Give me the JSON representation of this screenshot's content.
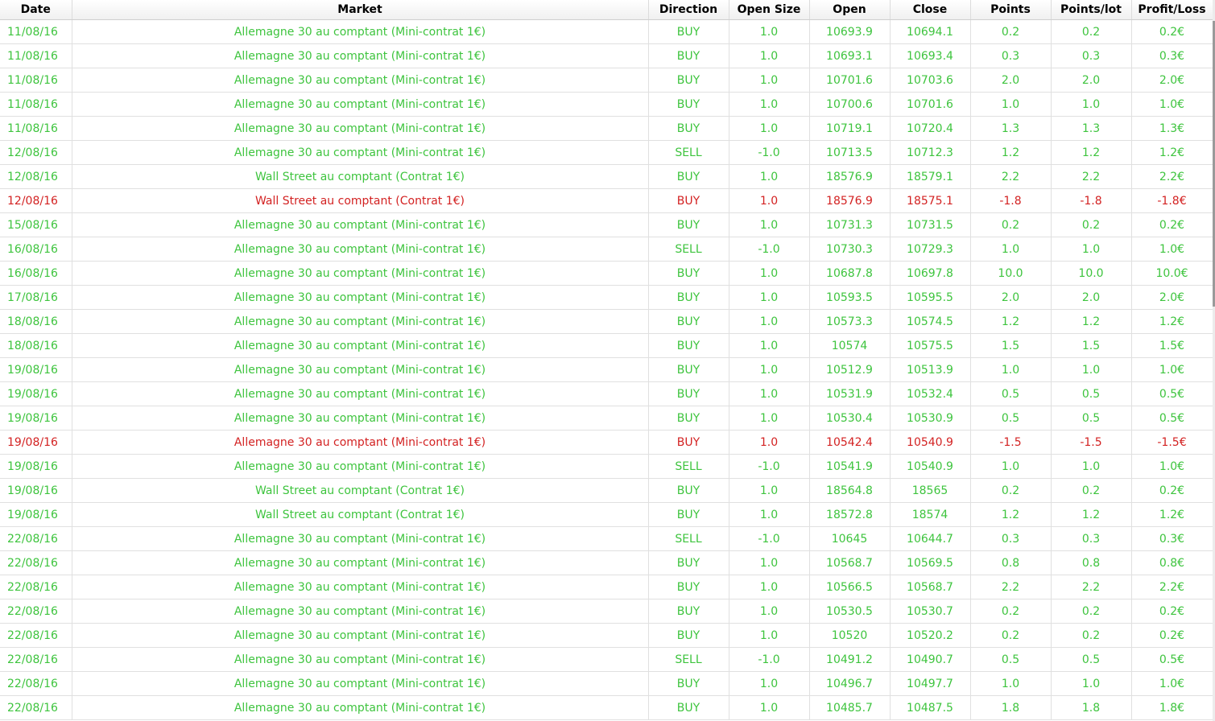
{
  "columns": [
    "Date",
    "Market",
    "Direction",
    "Open Size",
    "Open",
    "Close",
    "Points",
    "Points/lot",
    "Profit/Loss"
  ],
  "colors": {
    "profit": "#3ec43e",
    "loss": "#d32222"
  },
  "rows": [
    {
      "date": "11/08/16",
      "market": "Allemagne 30 au comptant (Mini-contrat 1€)",
      "direction": "BUY",
      "open_size": "1.0",
      "open": "10693.9",
      "close": "10694.1",
      "points": "0.2",
      "points_lot": "0.2",
      "pl": "0.2€",
      "status": "profit"
    },
    {
      "date": "11/08/16",
      "market": "Allemagne 30 au comptant (Mini-contrat 1€)",
      "direction": "BUY",
      "open_size": "1.0",
      "open": "10693.1",
      "close": "10693.4",
      "points": "0.3",
      "points_lot": "0.3",
      "pl": "0.3€",
      "status": "profit"
    },
    {
      "date": "11/08/16",
      "market": "Allemagne 30 au comptant (Mini-contrat 1€)",
      "direction": "BUY",
      "open_size": "1.0",
      "open": "10701.6",
      "close": "10703.6",
      "points": "2.0",
      "points_lot": "2.0",
      "pl": "2.0€",
      "status": "profit"
    },
    {
      "date": "11/08/16",
      "market": "Allemagne 30 au comptant (Mini-contrat 1€)",
      "direction": "BUY",
      "open_size": "1.0",
      "open": "10700.6",
      "close": "10701.6",
      "points": "1.0",
      "points_lot": "1.0",
      "pl": "1.0€",
      "status": "profit"
    },
    {
      "date": "11/08/16",
      "market": "Allemagne 30 au comptant (Mini-contrat 1€)",
      "direction": "BUY",
      "open_size": "1.0",
      "open": "10719.1",
      "close": "10720.4",
      "points": "1.3",
      "points_lot": "1.3",
      "pl": "1.3€",
      "status": "profit"
    },
    {
      "date": "12/08/16",
      "market": "Allemagne 30 au comptant (Mini-contrat 1€)",
      "direction": "SELL",
      "open_size": "-1.0",
      "open": "10713.5",
      "close": "10712.3",
      "points": "1.2",
      "points_lot": "1.2",
      "pl": "1.2€",
      "status": "profit"
    },
    {
      "date": "12/08/16",
      "market": "Wall Street au comptant (Contrat 1€)",
      "direction": "BUY",
      "open_size": "1.0",
      "open": "18576.9",
      "close": "18579.1",
      "points": "2.2",
      "points_lot": "2.2",
      "pl": "2.2€",
      "status": "profit"
    },
    {
      "date": "12/08/16",
      "market": "Wall Street au comptant (Contrat 1€)",
      "direction": "BUY",
      "open_size": "1.0",
      "open": "18576.9",
      "close": "18575.1",
      "points": "-1.8",
      "points_lot": "-1.8",
      "pl": "-1.8€",
      "status": "loss"
    },
    {
      "date": "15/08/16",
      "market": "Allemagne 30 au comptant (Mini-contrat 1€)",
      "direction": "BUY",
      "open_size": "1.0",
      "open": "10731.3",
      "close": "10731.5",
      "points": "0.2",
      "points_lot": "0.2",
      "pl": "0.2€",
      "status": "profit"
    },
    {
      "date": "16/08/16",
      "market": "Allemagne 30 au comptant (Mini-contrat 1€)",
      "direction": "SELL",
      "open_size": "-1.0",
      "open": "10730.3",
      "close": "10729.3",
      "points": "1.0",
      "points_lot": "1.0",
      "pl": "1.0€",
      "status": "profit"
    },
    {
      "date": "16/08/16",
      "market": "Allemagne 30 au comptant (Mini-contrat 1€)",
      "direction": "BUY",
      "open_size": "1.0",
      "open": "10687.8",
      "close": "10697.8",
      "points": "10.0",
      "points_lot": "10.0",
      "pl": "10.0€",
      "status": "profit"
    },
    {
      "date": "17/08/16",
      "market": "Allemagne 30 au comptant (Mini-contrat 1€)",
      "direction": "BUY",
      "open_size": "1.0",
      "open": "10593.5",
      "close": "10595.5",
      "points": "2.0",
      "points_lot": "2.0",
      "pl": "2.0€",
      "status": "profit"
    },
    {
      "date": "18/08/16",
      "market": "Allemagne 30 au comptant (Mini-contrat 1€)",
      "direction": "BUY",
      "open_size": "1.0",
      "open": "10573.3",
      "close": "10574.5",
      "points": "1.2",
      "points_lot": "1.2",
      "pl": "1.2€",
      "status": "profit"
    },
    {
      "date": "18/08/16",
      "market": "Allemagne 30 au comptant (Mini-contrat 1€)",
      "direction": "BUY",
      "open_size": "1.0",
      "open": "10574",
      "close": "10575.5",
      "points": "1.5",
      "points_lot": "1.5",
      "pl": "1.5€",
      "status": "profit"
    },
    {
      "date": "19/08/16",
      "market": "Allemagne 30 au comptant (Mini-contrat 1€)",
      "direction": "BUY",
      "open_size": "1.0",
      "open": "10512.9",
      "close": "10513.9",
      "points": "1.0",
      "points_lot": "1.0",
      "pl": "1.0€",
      "status": "profit"
    },
    {
      "date": "19/08/16",
      "market": "Allemagne 30 au comptant (Mini-contrat 1€)",
      "direction": "BUY",
      "open_size": "1.0",
      "open": "10531.9",
      "close": "10532.4",
      "points": "0.5",
      "points_lot": "0.5",
      "pl": "0.5€",
      "status": "profit"
    },
    {
      "date": "19/08/16",
      "market": "Allemagne 30 au comptant (Mini-contrat 1€)",
      "direction": "BUY",
      "open_size": "1.0",
      "open": "10530.4",
      "close": "10530.9",
      "points": "0.5",
      "points_lot": "0.5",
      "pl": "0.5€",
      "status": "profit"
    },
    {
      "date": "19/08/16",
      "market": "Allemagne 30 au comptant (Mini-contrat 1€)",
      "direction": "BUY",
      "open_size": "1.0",
      "open": "10542.4",
      "close": "10540.9",
      "points": "-1.5",
      "points_lot": "-1.5",
      "pl": "-1.5€",
      "status": "loss"
    },
    {
      "date": "19/08/16",
      "market": "Allemagne 30 au comptant (Mini-contrat 1€)",
      "direction": "SELL",
      "open_size": "-1.0",
      "open": "10541.9",
      "close": "10540.9",
      "points": "1.0",
      "points_lot": "1.0",
      "pl": "1.0€",
      "status": "profit"
    },
    {
      "date": "19/08/16",
      "market": "Wall Street au comptant (Contrat 1€)",
      "direction": "BUY",
      "open_size": "1.0",
      "open": "18564.8",
      "close": "18565",
      "points": "0.2",
      "points_lot": "0.2",
      "pl": "0.2€",
      "status": "profit"
    },
    {
      "date": "19/08/16",
      "market": "Wall Street au comptant (Contrat 1€)",
      "direction": "BUY",
      "open_size": "1.0",
      "open": "18572.8",
      "close": "18574",
      "points": "1.2",
      "points_lot": "1.2",
      "pl": "1.2€",
      "status": "profit"
    },
    {
      "date": "22/08/16",
      "market": "Allemagne 30 au comptant (Mini-contrat 1€)",
      "direction": "SELL",
      "open_size": "-1.0",
      "open": "10645",
      "close": "10644.7",
      "points": "0.3",
      "points_lot": "0.3",
      "pl": "0.3€",
      "status": "profit"
    },
    {
      "date": "22/08/16",
      "market": "Allemagne 30 au comptant (Mini-contrat 1€)",
      "direction": "BUY",
      "open_size": "1.0",
      "open": "10568.7",
      "close": "10569.5",
      "points": "0.8",
      "points_lot": "0.8",
      "pl": "0.8€",
      "status": "profit"
    },
    {
      "date": "22/08/16",
      "market": "Allemagne 30 au comptant (Mini-contrat 1€)",
      "direction": "BUY",
      "open_size": "1.0",
      "open": "10566.5",
      "close": "10568.7",
      "points": "2.2",
      "points_lot": "2.2",
      "pl": "2.2€",
      "status": "profit"
    },
    {
      "date": "22/08/16",
      "market": "Allemagne 30 au comptant (Mini-contrat 1€)",
      "direction": "BUY",
      "open_size": "1.0",
      "open": "10530.5",
      "close": "10530.7",
      "points": "0.2",
      "points_lot": "0.2",
      "pl": "0.2€",
      "status": "profit"
    },
    {
      "date": "22/08/16",
      "market": "Allemagne 30 au comptant (Mini-contrat 1€)",
      "direction": "BUY",
      "open_size": "1.0",
      "open": "10520",
      "close": "10520.2",
      "points": "0.2",
      "points_lot": "0.2",
      "pl": "0.2€",
      "status": "profit"
    },
    {
      "date": "22/08/16",
      "market": "Allemagne 30 au comptant (Mini-contrat 1€)",
      "direction": "SELL",
      "open_size": "-1.0",
      "open": "10491.2",
      "close": "10490.7",
      "points": "0.5",
      "points_lot": "0.5",
      "pl": "0.5€",
      "status": "profit"
    },
    {
      "date": "22/08/16",
      "market": "Allemagne 30 au comptant (Mini-contrat 1€)",
      "direction": "BUY",
      "open_size": "1.0",
      "open": "10496.7",
      "close": "10497.7",
      "points": "1.0",
      "points_lot": "1.0",
      "pl": "1.0€",
      "status": "profit"
    },
    {
      "date": "22/08/16",
      "market": "Allemagne 30 au comptant (Mini-contrat 1€)",
      "direction": "BUY",
      "open_size": "1.0",
      "open": "10485.7",
      "close": "10487.5",
      "points": "1.8",
      "points_lot": "1.8",
      "pl": "1.8€",
      "status": "profit"
    }
  ]
}
